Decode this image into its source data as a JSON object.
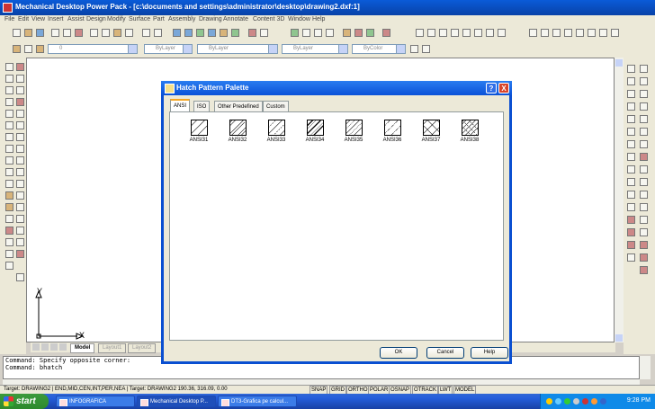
{
  "app": {
    "title": "Mechanical Desktop Power Pack - [c:\\documents and settings\\administrator\\desktop\\drawing2.dxf:1]",
    "window_controls": [
      "_",
      "□",
      "X"
    ]
  },
  "menu": [
    "File",
    "Edit",
    "View",
    "Insert",
    "Assist",
    "Design",
    "Modify",
    "Surface",
    "Part",
    "Assembly",
    "Drawing",
    "Annotate",
    "Content 3D",
    "Window",
    "Help"
  ],
  "layer_toolbar": {
    "layer_combo": "0",
    "color_combo": "ByLayer",
    "linetype_combo": "ByLayer",
    "lineweight_combo": "ByLayer",
    "plotstyle_combo": "ByColor"
  },
  "ucs": {
    "x_label": "X",
    "y_label": "Y"
  },
  "layout_tabs": [
    {
      "label": "Model",
      "active": true
    },
    {
      "label": "Layout1",
      "active": false
    },
    {
      "label": "Layout2",
      "active": false
    }
  ],
  "command_lines": [
    "Command: Specify opposite corner:",
    "Command: bhatch"
  ],
  "status": {
    "coords": "Target: DRAWING2 | END,MID,CEN,INT,PER,NEA | Target: DRAWING2 190.36, 316.09, 0.00",
    "toggles": [
      "SNAP",
      "GRID",
      "ORTHO",
      "POLAR",
      "OSNAP",
      "OTRACK",
      "LWT",
      "MODEL"
    ]
  },
  "dialog": {
    "title": "Hatch Pattern Palette",
    "help_glyph": "?",
    "close_glyph": "X",
    "tabs": [
      {
        "label": "ANSI",
        "selected": true
      },
      {
        "label": "ISO",
        "selected": false
      },
      {
        "label": "Other Predefined",
        "selected": false
      },
      {
        "label": "Custom",
        "selected": false
      }
    ],
    "patterns": [
      "ANSI31",
      "ANSI32",
      "ANSI33",
      "ANSI34",
      "ANSI35",
      "ANSI36",
      "ANSI37",
      "ANSI38"
    ],
    "buttons": {
      "ok": "OK",
      "cancel": "Cancel",
      "help": "Help"
    }
  },
  "taskbar": {
    "start": "start",
    "tasks": [
      {
        "label": "INFOGRAFICA",
        "active": false
      },
      {
        "label": "Mechanical Desktop P...",
        "active": true
      },
      {
        "label": "DT3-Grafica pe calcul...",
        "active": false
      }
    ],
    "clock": "9:28 PM"
  },
  "colors": {
    "titlebar": "#0a52d8",
    "dialog_frame": "#0a4fd1",
    "taskbar": "#245edb",
    "start": "#2d8a2d"
  }
}
